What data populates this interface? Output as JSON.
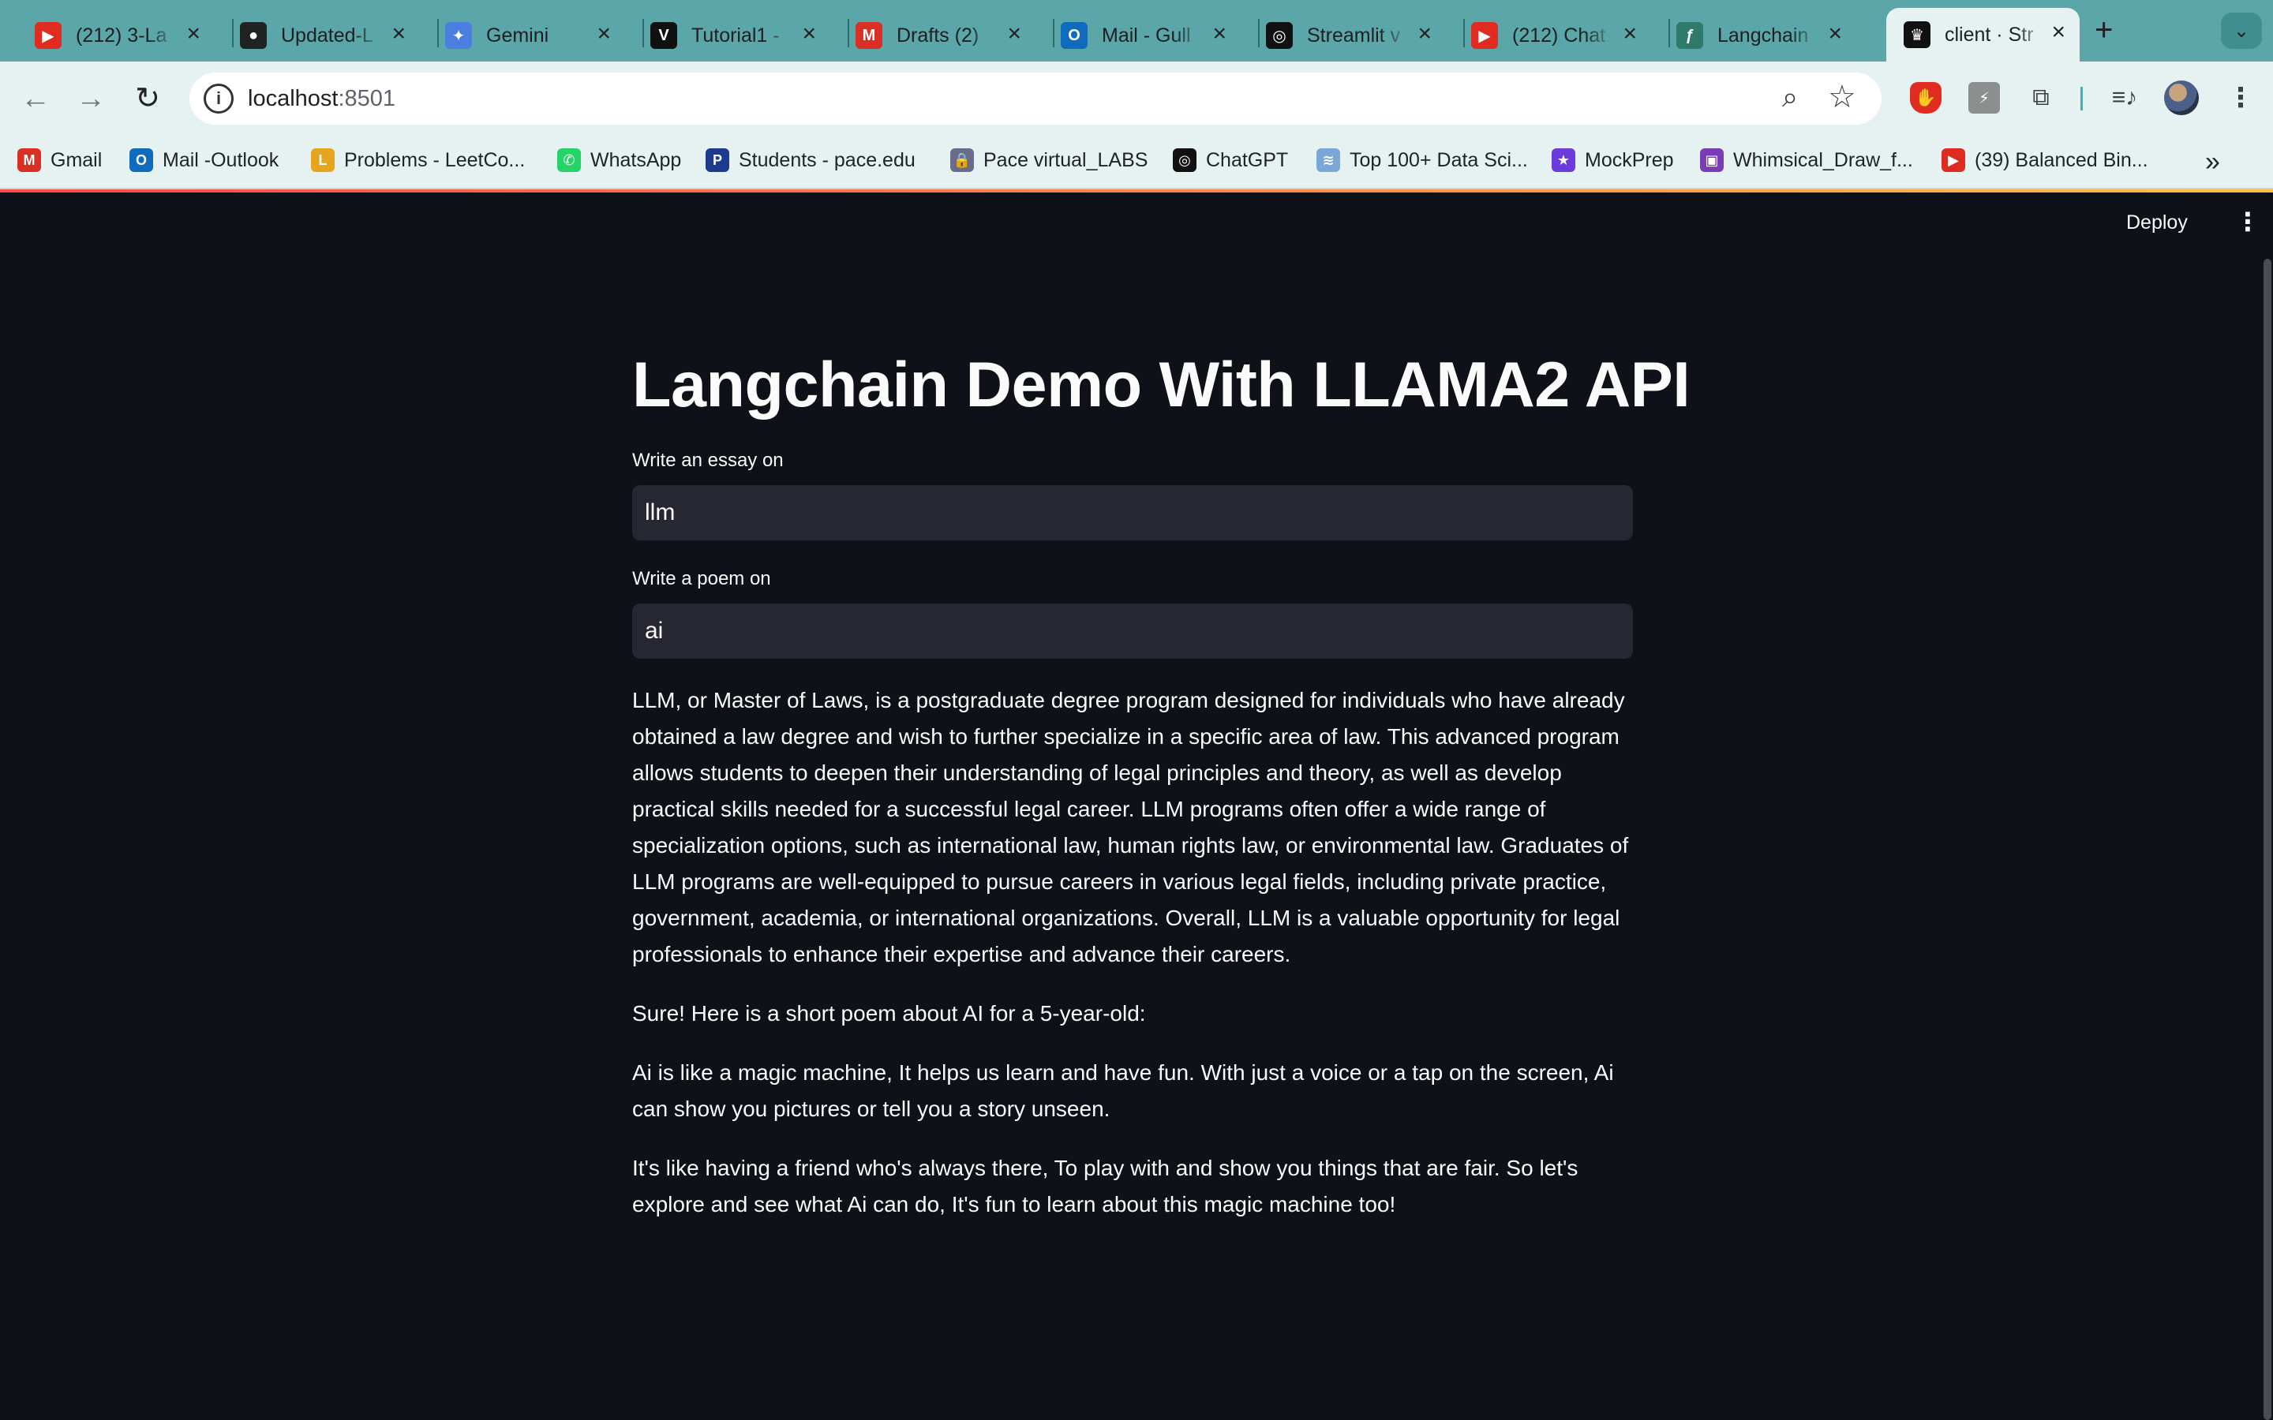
{
  "browser": {
    "tabs": [
      {
        "title": "(212) 3-La",
        "icon": "youtube-icon",
        "color": "#e02b20"
      },
      {
        "title": "Updated-L",
        "icon": "github-icon",
        "color": "#1f2322"
      },
      {
        "title": "Gemini",
        "icon": "gemini-icon",
        "color": "#4a7fe0"
      },
      {
        "title": "Tutorial1 -",
        "icon": "tutorial-icon",
        "color": "#111111"
      },
      {
        "title": "Drafts (2)",
        "icon": "gmail-icon",
        "color": "#d93025"
      },
      {
        "title": "Mail - Gull",
        "icon": "outlook-icon",
        "color": "#0f6cbd"
      },
      {
        "title": "Streamlit v",
        "icon": "openai-icon",
        "color": "#111111"
      },
      {
        "title": "(212) Chat",
        "icon": "youtube-icon",
        "color": "#e02b20"
      },
      {
        "title": "Langchain",
        "icon": "langchain-icon",
        "color": "#2f7a6a"
      },
      {
        "title": "client · Str",
        "icon": "streamlit-icon",
        "color": "#111111"
      }
    ],
    "active_tab_index": 9,
    "url_host": "localhost",
    "url_port": ":8501",
    "bookmarks": [
      {
        "label": "Gmail",
        "icon": "gmail-icon",
        "color": "#d93025"
      },
      {
        "label": "Mail -Outlook",
        "icon": "outlook-icon",
        "color": "#0f6cbd"
      },
      {
        "label": "Problems - LeetCo...",
        "icon": "leetcode-icon",
        "color": "#e7a41f"
      },
      {
        "label": "WhatsApp",
        "icon": "whatsapp-icon",
        "color": "#25d366"
      },
      {
        "label": "Students - pace.edu",
        "icon": "pace-icon",
        "color": "#1d3a8f"
      },
      {
        "label": "Pace virtual_LABS",
        "icon": "lock-icon",
        "color": "#6a6a8a"
      },
      {
        "label": "ChatGPT",
        "icon": "openai-icon",
        "color": "#111111"
      },
      {
        "label": "Top 100+ Data Sci...",
        "icon": "data-icon",
        "color": "#7aa7d8"
      },
      {
        "label": "MockPrep",
        "icon": "mockprep-icon",
        "color": "#6c3bdb"
      },
      {
        "label": "Whimsical_Draw_f...",
        "icon": "whimsical-icon",
        "color": "#7b3bb5"
      },
      {
        "label": "(39) Balanced Bin...",
        "icon": "youtube-icon",
        "color": "#e02b20"
      }
    ]
  },
  "app": {
    "deploy_label": "Deploy",
    "title": "Langchain Demo With LLAMA2 API",
    "essay_label": "Write an essay on",
    "essay_value": "llm",
    "poem_label": "Write a poem on",
    "poem_value": "ai",
    "essay_output": "LLM, or Master of Laws, is a postgraduate degree program designed for individuals who have already obtained a law degree and wish to further specialize in a specific area of law. This advanced program allows students to deepen their understanding of legal principles and theory, as well as develop practical skills needed for a successful legal career. LLM programs often offer a wide range of specialization options, such as international law, human rights law, or environmental law. Graduates of LLM programs are well-equipped to pursue careers in various legal fields, including private practice, government, academia, or international organizations. Overall, LLM is a valuable opportunity for legal professionals to enhance their expertise and advance their careers.",
    "poem_intro": "Sure! Here is a short poem about AI for a 5-year-old:",
    "poem_stanza_1": "Ai is like a magic machine, It helps us learn and have fun. With just a voice or a tap on the screen, Ai can show you pictures or tell you a story unseen.",
    "poem_stanza_2": "It's like having a friend who's always there, To play with and show you things that are fair. So let's explore and see what Ai can do, It's fun to learn about this magic machine too!"
  }
}
